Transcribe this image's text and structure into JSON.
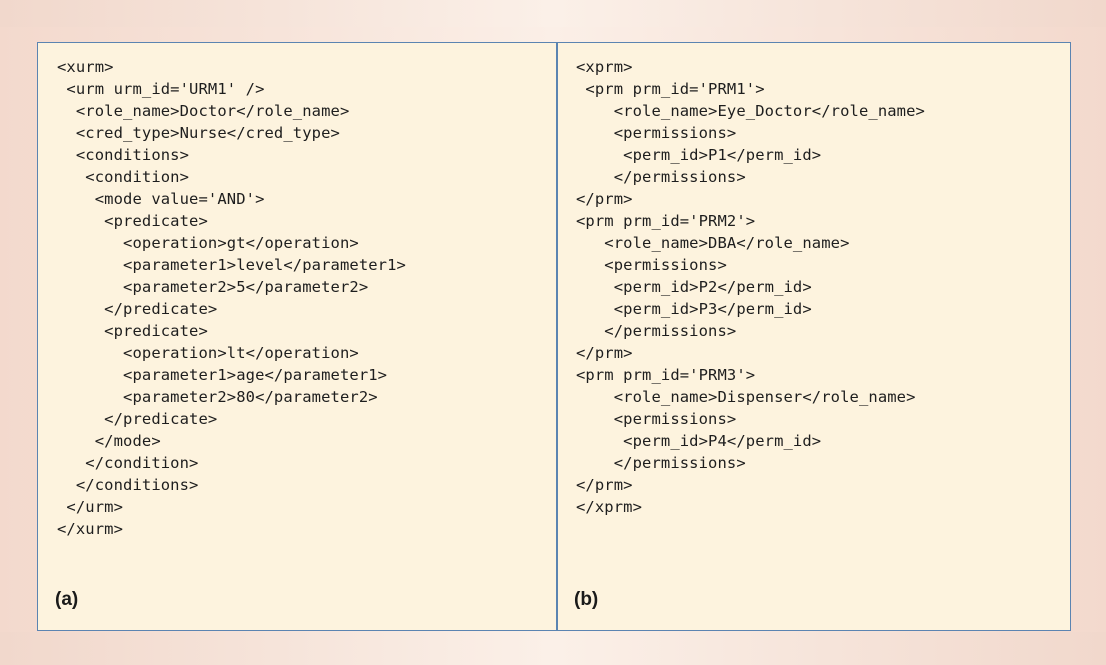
{
  "panel_a": {
    "code": "<xurm>\n <urm urm_id='URM1' />\n  <role_name>Doctor</role_name>\n  <cred_type>Nurse</cred_type>\n  <conditions>\n   <condition>\n    <mode value='AND'>\n     <predicate>\n       <operation>gt</operation>\n       <parameter1>level</parameter1>\n       <parameter2>5</parameter2>\n     </predicate>\n     <predicate>\n       <operation>lt</operation>\n       <parameter1>age</parameter1>\n       <parameter2>80</parameter2>\n     </predicate>\n    </mode>\n   </condition>\n  </conditions>\n </urm>\n</xurm>",
    "label": "(a)"
  },
  "panel_b": {
    "code": "<xprm>\n <prm prm_id='PRM1'>\n    <role_name>Eye_Doctor</role_name>\n    <permissions>\n     <perm_id>P1</perm_id>\n    </permissions>\n</prm>\n<prm prm_id='PRM2'>\n   <role_name>DBA</role_name>\n   <permissions>\n    <perm_id>P2</perm_id>\n    <perm_id>P3</perm_id>\n   </permissions>\n</prm>\n<prm prm_id='PRM3'>\n    <role_name>Dispenser</role_name>\n    <permissions>\n     <perm_id>P4</perm_id>\n    </permissions>\n</prm>\n</xprm>",
    "label": "(b)"
  },
  "colors": {
    "border": "#5b84b1",
    "panel_background": "#fdf3de",
    "page_background": "#f3d9cd"
  }
}
